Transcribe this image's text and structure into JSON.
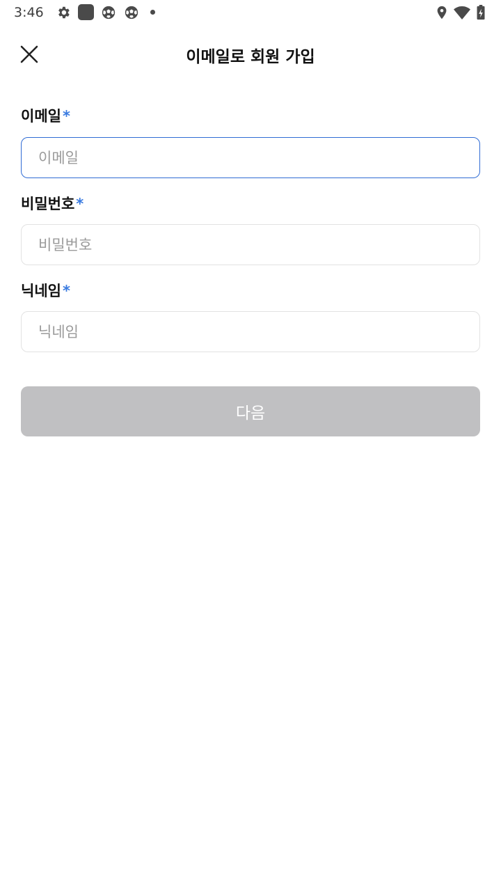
{
  "status_bar": {
    "time": "3:46",
    "icons": [
      "gear-icon",
      "app-square-icon",
      "soccer-ball-icon",
      "soccer-ball-icon",
      "dot-icon",
      "location-icon",
      "wifi-icon",
      "battery-icon"
    ]
  },
  "header": {
    "title": "이메일로 회원 가입",
    "close_icon": "close-icon"
  },
  "form": {
    "required_mark": "*",
    "email": {
      "label": "이메일",
      "placeholder": "이메일",
      "value": ""
    },
    "password": {
      "label": "비밀번호",
      "placeholder": "비밀번호",
      "value": ""
    },
    "nickname": {
      "label": "닉네임",
      "placeholder": "닉네임",
      "value": ""
    },
    "submit_label": "다음"
  },
  "colors": {
    "accent": "#3a7be0",
    "focus_border": "#2f6bd4",
    "disabled_button": "#c0c0c2"
  }
}
